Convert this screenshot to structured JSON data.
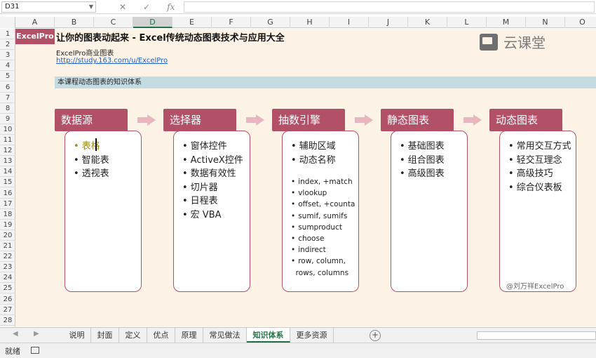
{
  "formula_bar": {
    "namebox": "D31",
    "cancel_icon": "✕",
    "enter_icon": "✓",
    "fx_label": "fx",
    "formula": ""
  },
  "columns": [
    "A",
    "B",
    "C",
    "D",
    "E",
    "F",
    "G",
    "H",
    "I",
    "J",
    "K",
    "L",
    "M",
    "N",
    "O"
  ],
  "selected_column": "D",
  "rows": [
    "1",
    "2",
    "3",
    "4",
    "5",
    "6",
    "7",
    "8",
    "9",
    "10",
    "11",
    "12",
    "13",
    "14",
    "15",
    "16",
    "17",
    "18",
    "19",
    "20",
    "21",
    "22",
    "23",
    "24",
    "25",
    "26",
    "27",
    "28"
  ],
  "sheet": {
    "logo": "ExcelPro",
    "title": "让你的图表动起来 - Excel传统动态图表技术与应用大全",
    "subtitle": "ExcelPro商业图表",
    "link": "http://study.163.com/u/ExcelPro",
    "section_band": "本课程动态图表的知识体系",
    "brand": "云课堂",
    "watermark": "@刘万祥ExcelPro"
  },
  "cards": [
    {
      "title": "数据源",
      "items": [
        "表格",
        "智能表",
        "透视表"
      ],
      "sub_items": []
    },
    {
      "title": "选择器",
      "items": [
        "窗体控件",
        "ActiveX控件",
        "数据有效性",
        "切片器",
        "日程表",
        "宏 VBA"
      ],
      "sub_items": []
    },
    {
      "title": "抽数引擎",
      "items": [
        "辅助区域",
        "动态名称"
      ],
      "sub_items": [
        "index, +match",
        "vlookup",
        "offset, +counta",
        "sumif, sumifs",
        "sumproduct",
        "choose",
        "indirect",
        "row, column,\n  rows, columns"
      ]
    },
    {
      "title": "静态图表",
      "items": [
        "基础图表",
        "组合图表",
        "高级图表"
      ],
      "sub_items": []
    },
    {
      "title": "动态图表",
      "items": [
        "常用交互方式",
        "轻交互理念",
        "高级技巧",
        "综合仪表板"
      ],
      "sub_items": []
    }
  ],
  "tabs": [
    "说明",
    "封面",
    "定义",
    "优点",
    "原理",
    "常见做法",
    "知识体系",
    "更多资源"
  ],
  "active_tab": "知识体系",
  "add_sheet_label": "+",
  "status": {
    "text": "就绪"
  },
  "colors": {
    "accent": "#b25068",
    "excel_green": "#217346",
    "cell_bg": "#fdf2e6",
    "band": "#c3dbe3"
  }
}
